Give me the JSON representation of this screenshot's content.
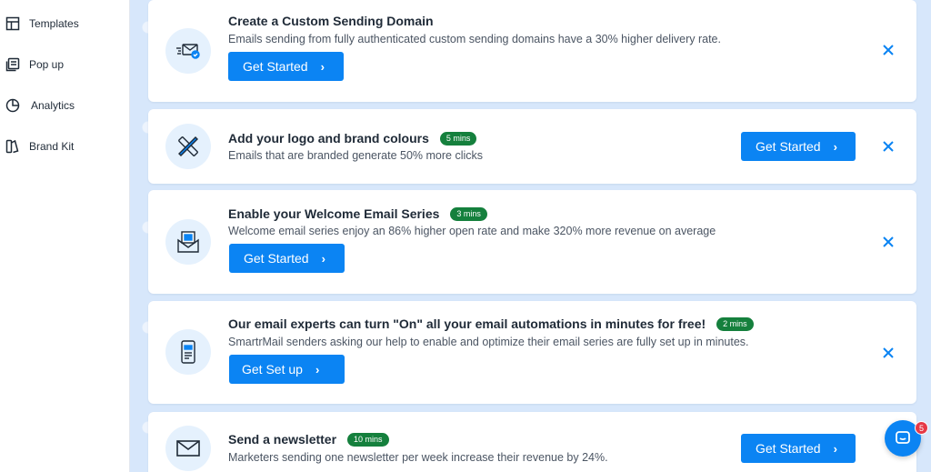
{
  "sidebar": {
    "items": [
      {
        "label": "Templates",
        "icon": "layout-icon"
      },
      {
        "label": "Pop up",
        "icon": "popup-icon"
      },
      {
        "label": "Analytics",
        "icon": "pie-chart-icon"
      },
      {
        "label": "Brand Kit",
        "icon": "brand-kit-icon"
      }
    ]
  },
  "cards": [
    {
      "title": "Create a Custom Sending Domain",
      "badge": "",
      "description": "Emails sending from fully authenticated custom sending domains have a 30% higher delivery rate.",
      "button": "Get Started",
      "icon": "send-mail-icon"
    },
    {
      "title": "Add your logo and brand colours",
      "badge": "5 mins",
      "description": "Emails that are branded generate 50% more clicks",
      "button": "Get Started",
      "icon": "design-tools-icon"
    },
    {
      "title": "Enable your Welcome Email Series",
      "badge": "3 mins",
      "description": "Welcome email series enjoy an 86% higher open rate and make 320% more revenue on average",
      "button": "Get Started",
      "icon": "welcome-mail-icon"
    },
    {
      "title": "Our email experts can turn \"On\" all your email automations in minutes for free!",
      "badge": "2 mins",
      "description": "SmartrMail senders asking our help to enable and optimize their email series are fully set up in minutes.",
      "button": "Get Set up",
      "icon": "document-icon"
    },
    {
      "title": "Send a newsletter",
      "badge": "10 mins",
      "description": "Marketers sending one newsletter per week increase their revenue by 24%.",
      "button": "Get Started",
      "icon": "envelope-icon"
    }
  ],
  "chat": {
    "badge": "5",
    "icon": "chat-icon"
  },
  "colors": {
    "accent": "#0b84f3",
    "badge": "#15803d",
    "background": "#d7e7fb"
  }
}
